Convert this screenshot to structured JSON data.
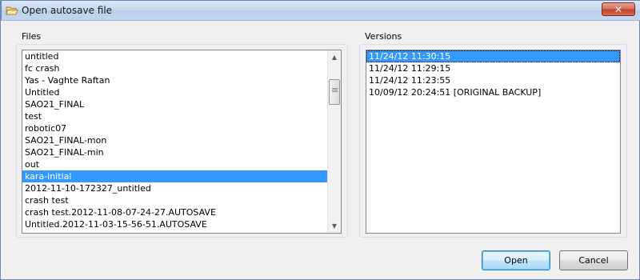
{
  "window": {
    "title": "Open autosave file",
    "close_glyph": "✕"
  },
  "files": {
    "label": "Files",
    "items": [
      "untitled",
      "fc crash",
      "Yas - Vaghte Raftan",
      "Untitled",
      "SAO21_FINAL",
      "test",
      "robotic07",
      "SAO21_FINAL-mon",
      "SAO21_FINAL-min",
      "out",
      "kara-initial",
      "2012-11-10-172327_untitled",
      "crash test",
      "crash test.2012-11-08-07-24-27.AUTOSAVE",
      "Untitled.2012-11-03-15-56-51.AUTOSAVE"
    ],
    "selected_index": 10,
    "scroll_position": 0.12
  },
  "versions": {
    "label": "Versions",
    "items": [
      "11/24/12 11:30:15",
      "11/24/12 11:29:15",
      "11/24/12 11:23:55",
      "10/09/12 20:24:51 [ORIGINAL BACKUP]"
    ],
    "selected_index": 0
  },
  "buttons": {
    "open": "Open",
    "cancel": "Cancel"
  },
  "icons": {
    "title": "folder-open-icon",
    "scroll_up": "▲",
    "scroll_down": "▼"
  }
}
